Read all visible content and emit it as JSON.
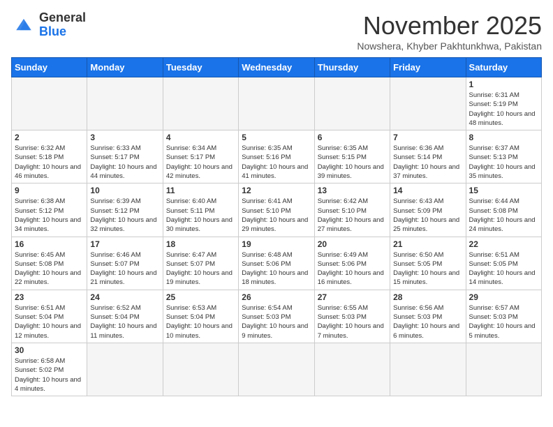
{
  "logo": {
    "text_general": "General",
    "text_blue": "Blue"
  },
  "header": {
    "title": "November 2025",
    "subtitle": "Nowshera, Khyber Pakhtunkhwa, Pakistan"
  },
  "weekdays": [
    "Sunday",
    "Monday",
    "Tuesday",
    "Wednesday",
    "Thursday",
    "Friday",
    "Saturday"
  ],
  "days": [
    {
      "num": "",
      "info": ""
    },
    {
      "num": "",
      "info": ""
    },
    {
      "num": "",
      "info": ""
    },
    {
      "num": "",
      "info": ""
    },
    {
      "num": "",
      "info": ""
    },
    {
      "num": "",
      "info": ""
    },
    {
      "num": "1",
      "info": "Sunrise: 6:31 AM\nSunset: 5:19 PM\nDaylight: 10 hours and 48 minutes."
    },
    {
      "num": "2",
      "info": "Sunrise: 6:32 AM\nSunset: 5:18 PM\nDaylight: 10 hours and 46 minutes."
    },
    {
      "num": "3",
      "info": "Sunrise: 6:33 AM\nSunset: 5:17 PM\nDaylight: 10 hours and 44 minutes."
    },
    {
      "num": "4",
      "info": "Sunrise: 6:34 AM\nSunset: 5:17 PM\nDaylight: 10 hours and 42 minutes."
    },
    {
      "num": "5",
      "info": "Sunrise: 6:35 AM\nSunset: 5:16 PM\nDaylight: 10 hours and 41 minutes."
    },
    {
      "num": "6",
      "info": "Sunrise: 6:35 AM\nSunset: 5:15 PM\nDaylight: 10 hours and 39 minutes."
    },
    {
      "num": "7",
      "info": "Sunrise: 6:36 AM\nSunset: 5:14 PM\nDaylight: 10 hours and 37 minutes."
    },
    {
      "num": "8",
      "info": "Sunrise: 6:37 AM\nSunset: 5:13 PM\nDaylight: 10 hours and 35 minutes."
    },
    {
      "num": "9",
      "info": "Sunrise: 6:38 AM\nSunset: 5:12 PM\nDaylight: 10 hours and 34 minutes."
    },
    {
      "num": "10",
      "info": "Sunrise: 6:39 AM\nSunset: 5:12 PM\nDaylight: 10 hours and 32 minutes."
    },
    {
      "num": "11",
      "info": "Sunrise: 6:40 AM\nSunset: 5:11 PM\nDaylight: 10 hours and 30 minutes."
    },
    {
      "num": "12",
      "info": "Sunrise: 6:41 AM\nSunset: 5:10 PM\nDaylight: 10 hours and 29 minutes."
    },
    {
      "num": "13",
      "info": "Sunrise: 6:42 AM\nSunset: 5:10 PM\nDaylight: 10 hours and 27 minutes."
    },
    {
      "num": "14",
      "info": "Sunrise: 6:43 AM\nSunset: 5:09 PM\nDaylight: 10 hours and 25 minutes."
    },
    {
      "num": "15",
      "info": "Sunrise: 6:44 AM\nSunset: 5:08 PM\nDaylight: 10 hours and 24 minutes."
    },
    {
      "num": "16",
      "info": "Sunrise: 6:45 AM\nSunset: 5:08 PM\nDaylight: 10 hours and 22 minutes."
    },
    {
      "num": "17",
      "info": "Sunrise: 6:46 AM\nSunset: 5:07 PM\nDaylight: 10 hours and 21 minutes."
    },
    {
      "num": "18",
      "info": "Sunrise: 6:47 AM\nSunset: 5:07 PM\nDaylight: 10 hours and 19 minutes."
    },
    {
      "num": "19",
      "info": "Sunrise: 6:48 AM\nSunset: 5:06 PM\nDaylight: 10 hours and 18 minutes."
    },
    {
      "num": "20",
      "info": "Sunrise: 6:49 AM\nSunset: 5:06 PM\nDaylight: 10 hours and 16 minutes."
    },
    {
      "num": "21",
      "info": "Sunrise: 6:50 AM\nSunset: 5:05 PM\nDaylight: 10 hours and 15 minutes."
    },
    {
      "num": "22",
      "info": "Sunrise: 6:51 AM\nSunset: 5:05 PM\nDaylight: 10 hours and 14 minutes."
    },
    {
      "num": "23",
      "info": "Sunrise: 6:51 AM\nSunset: 5:04 PM\nDaylight: 10 hours and 12 minutes."
    },
    {
      "num": "24",
      "info": "Sunrise: 6:52 AM\nSunset: 5:04 PM\nDaylight: 10 hours and 11 minutes."
    },
    {
      "num": "25",
      "info": "Sunrise: 6:53 AM\nSunset: 5:04 PM\nDaylight: 10 hours and 10 minutes."
    },
    {
      "num": "26",
      "info": "Sunrise: 6:54 AM\nSunset: 5:03 PM\nDaylight: 10 hours and 9 minutes."
    },
    {
      "num": "27",
      "info": "Sunrise: 6:55 AM\nSunset: 5:03 PM\nDaylight: 10 hours and 7 minutes."
    },
    {
      "num": "28",
      "info": "Sunrise: 6:56 AM\nSunset: 5:03 PM\nDaylight: 10 hours and 6 minutes."
    },
    {
      "num": "29",
      "info": "Sunrise: 6:57 AM\nSunset: 5:03 PM\nDaylight: 10 hours and 5 minutes."
    },
    {
      "num": "30",
      "info": "Sunrise: 6:58 AM\nSunset: 5:02 PM\nDaylight: 10 hours and 4 minutes."
    },
    {
      "num": "",
      "info": ""
    },
    {
      "num": "",
      "info": ""
    },
    {
      "num": "",
      "info": ""
    },
    {
      "num": "",
      "info": ""
    },
    {
      "num": "",
      "info": ""
    },
    {
      "num": "",
      "info": ""
    }
  ]
}
